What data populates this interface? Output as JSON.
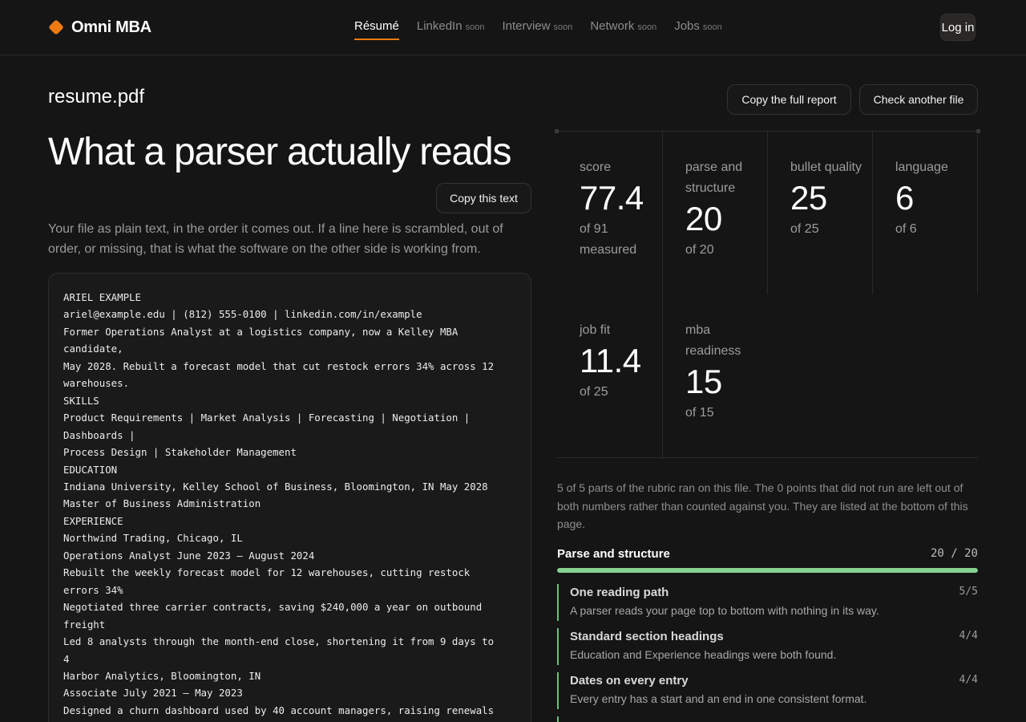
{
  "app": {
    "brand": "Omni MBA",
    "nav": [
      {
        "label": "Résumé",
        "badge": "",
        "active": true
      },
      {
        "label": "LinkedIn",
        "badge": "soon",
        "active": false
      },
      {
        "label": "Interview",
        "badge": "soon",
        "active": false
      },
      {
        "label": "Network",
        "badge": "soon",
        "active": false
      },
      {
        "label": "Jobs",
        "badge": "soon",
        "active": false
      }
    ],
    "login_label": "Log in",
    "accent_color": "#f07a12",
    "success_color": "#86d391"
  },
  "report": {
    "file_name": "resume.pdf",
    "copy_report_label": "Copy the full report",
    "check_another_label": "Check another file"
  },
  "parser": {
    "title": "What a parser actually reads",
    "copy_text_label": "Copy this text",
    "intro": "Your file as plain text, in the order it comes out. If a line here is scrambled, out of order, or missing, that is what the software on the other side is working from.",
    "extracted_text": "ARIEL EXAMPLE\nariel@example.edu | (812) 555-0100 | linkedin.com/in/example\nFormer Operations Analyst at a logistics company, now a Kelley MBA\ncandidate,\nMay 2028. Rebuilt a forecast model that cut restock errors 34% across 12\nwarehouses.\nSKILLS\nProduct Requirements | Market Analysis | Forecasting | Negotiation |\nDashboards |\nProcess Design | Stakeholder Management\nEDUCATION\nIndiana University, Kelley School of Business, Bloomington, IN May 2028\nMaster of Business Administration\nEXPERIENCE\nNorthwind Trading, Chicago, IL\nOperations Analyst June 2023 – August 2024\nRebuilt the weekly forecast model for 12 warehouses, cutting restock\nerrors 34%\nNegotiated three carrier contracts, saving $240,000 a year on outbound\nfreight\nLed 8 analysts through the month-end close, shortening it from 9 days to\n4\nHarbor Analytics, Bloomington, IN\nAssociate July 2021 – May 2023\nDesigned a churn dashboard used by 40 account managers, raising renewals"
  },
  "scores": [
    {
      "label": "score",
      "value": "77.4",
      "of": "of 91 measured"
    },
    {
      "label": "parse and structure",
      "value": "20",
      "of": "of 20"
    },
    {
      "label": "bullet quality",
      "value": "25",
      "of": "of 25"
    },
    {
      "label": "language",
      "value": "6",
      "of": "of 6"
    },
    {
      "label": "job fit",
      "value": "11.4",
      "of": "of 25"
    },
    {
      "label": "mba readiness",
      "value": "15",
      "of": "of 15"
    }
  ],
  "rubric_note": "5 of 5 parts of the rubric ran on this file. The 0 points that did not run are left out of both numbers rather than counted against you. They are listed at the bottom of this page.",
  "section": {
    "title": "Parse and structure",
    "score": "20 / 20",
    "progress": 1.0,
    "checks": [
      {
        "title": "One reading path",
        "score": "5/5",
        "desc": "A parser reads your page top to bottom with nothing in its way."
      },
      {
        "title": "Standard section headings",
        "score": "4/4",
        "desc": "Education and Experience headings were both found."
      },
      {
        "title": "Dates on every entry",
        "score": "4/4",
        "desc": "Every entry has a start and an end in one consistent format."
      }
    ]
  }
}
